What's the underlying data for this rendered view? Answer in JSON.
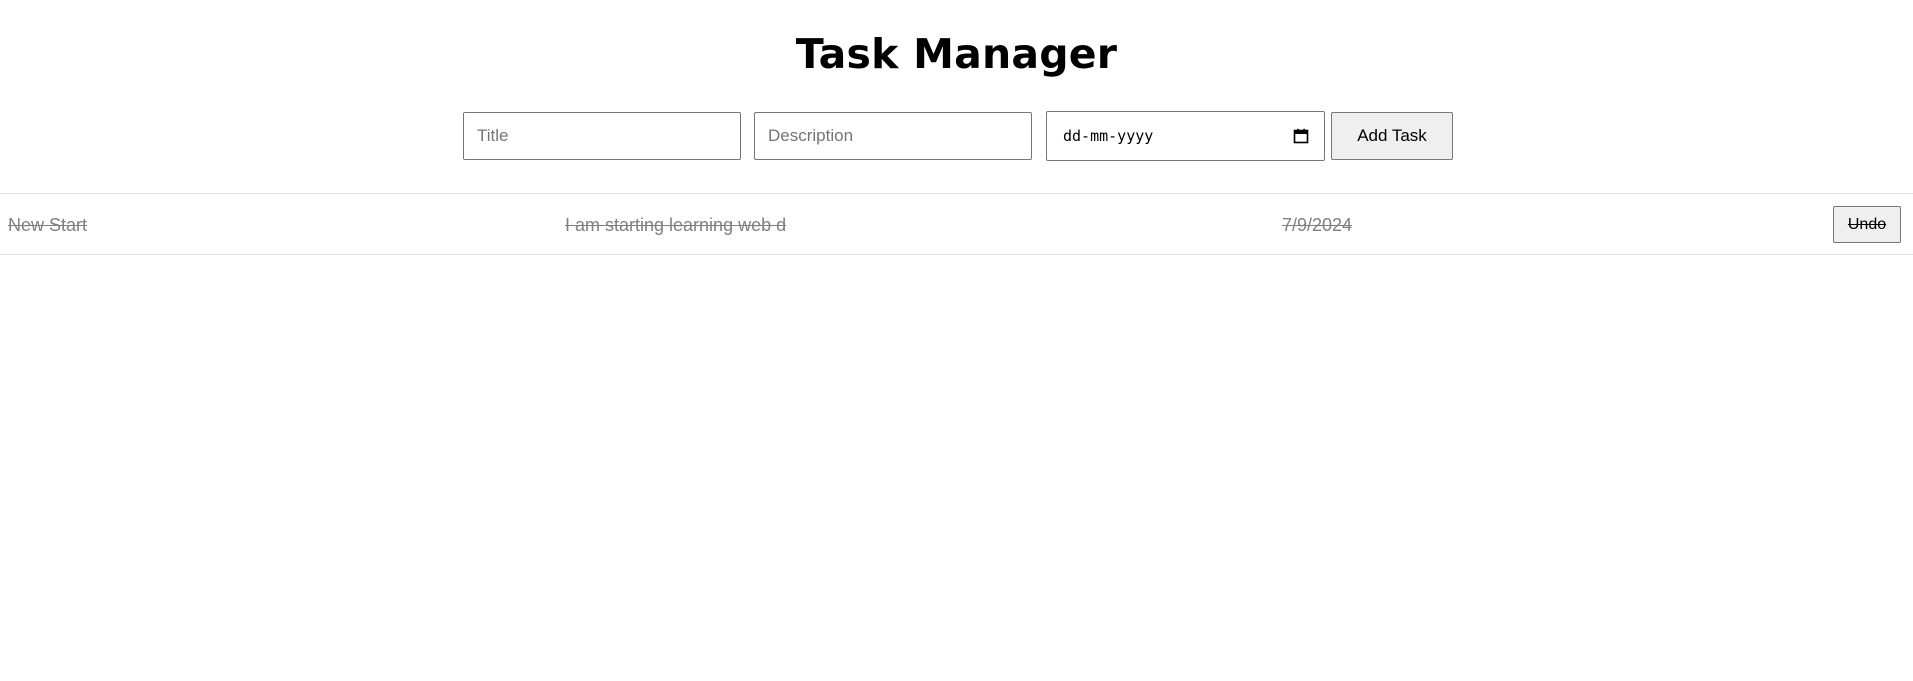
{
  "header": {
    "title": "Task Manager"
  },
  "form": {
    "title_placeholder": "Title",
    "description_placeholder": "Description",
    "date_placeholder": "dd-mm-yyyy",
    "add_label": "Add Task"
  },
  "tasks": [
    {
      "title": "New Start",
      "description": "I am starting learning web d",
      "date": "7/9/2024",
      "completed": true,
      "action_label": "Undo"
    }
  ],
  "colors": {
    "completed_text": "#808080",
    "row_border": "#dddddd",
    "button_bg": "#efefef"
  },
  "icons": {
    "date_picker": "calendar-icon"
  }
}
